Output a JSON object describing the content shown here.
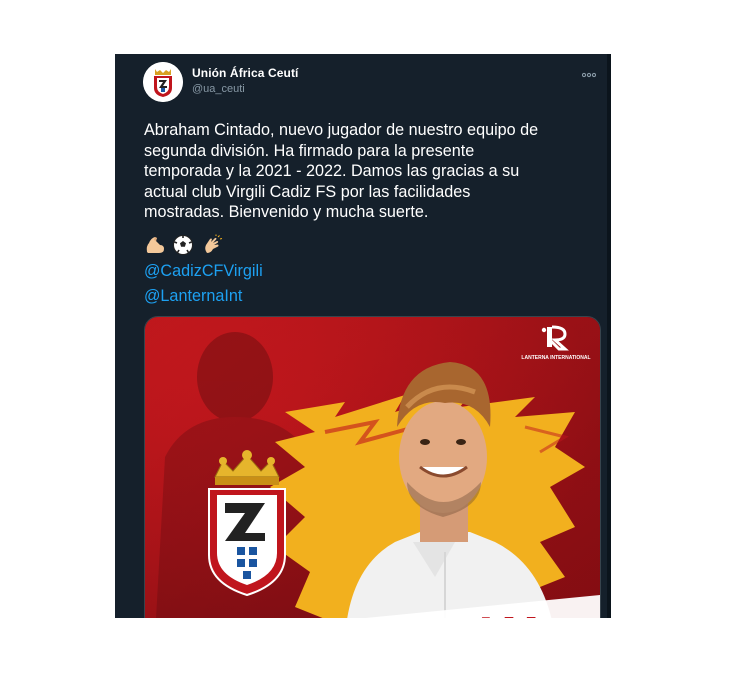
{
  "tweet": {
    "author": {
      "name": "Unión África Ceutí",
      "handle": "@ua_ceuti"
    },
    "text": "Abraham Cintado, nuevo jugador de nuestro equipo de\nsegunda división. Ha firmado para la presente\ntemporada y la 2021 - 2022.  Damos las gracias a su\nactual club Virgili Cadiz FS por las facilidades\nmostradas. Bienvenido y mucha suerte.",
    "emojis": [
      "flexed-biceps",
      "soccer-ball",
      "clapping-hands"
    ],
    "mentions": [
      "@CadizCFVirgili",
      "@LanternaInt"
    ],
    "media": {
      "sponsor_logo_text": "LANTERNA INTERNATIONAL",
      "partial_banner_text": "AM"
    }
  },
  "colors": {
    "background": "#15202b",
    "text": "#ffffff",
    "secondary_text": "#8899a6",
    "link": "#1da1f2",
    "media_red": "#c0151d",
    "media_yellow": "#f2b01e"
  }
}
